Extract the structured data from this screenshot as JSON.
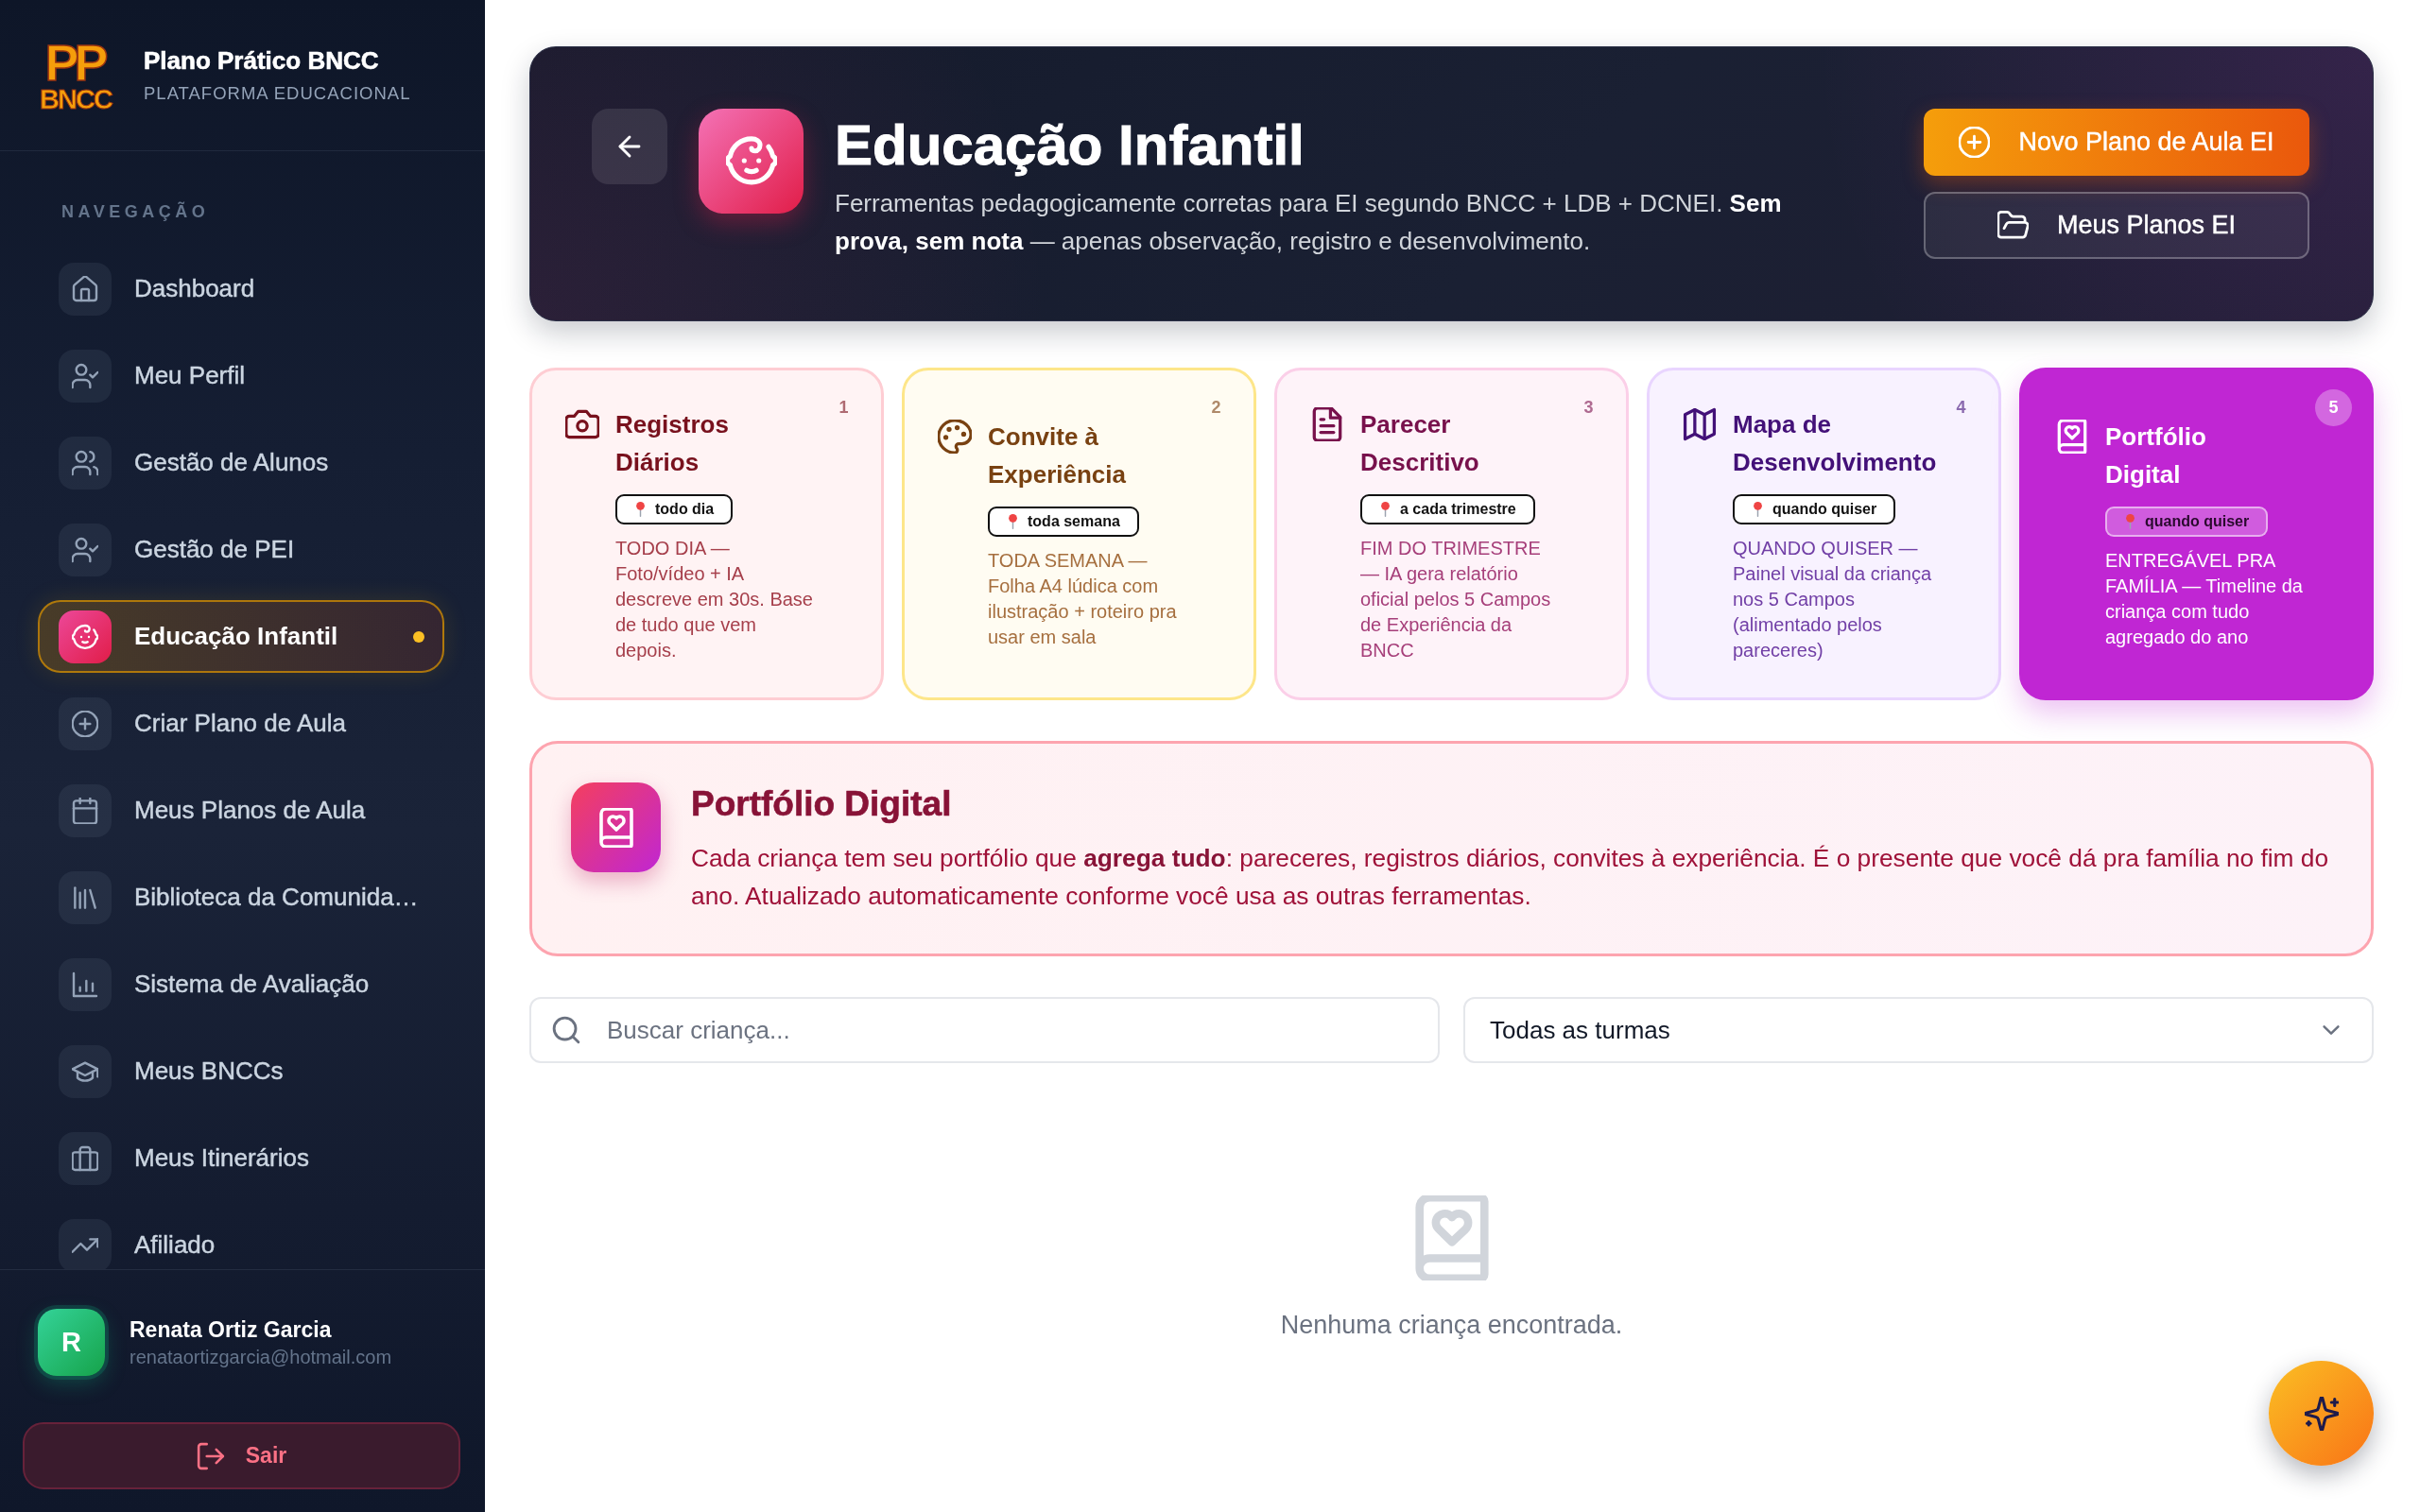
{
  "sidebar": {
    "logo": {
      "monogram": "PP",
      "wordmark": "BNCC"
    },
    "title": "Plano Prático BNCC",
    "subtitle": "PLATAFORMA EDUCACIONAL",
    "section_label": "NAVEGAÇÃO",
    "items": [
      {
        "label": "Dashboard",
        "selected": false
      },
      {
        "label": "Meu Perfil",
        "selected": false
      },
      {
        "label": "Gestão de Alunos",
        "selected": false
      },
      {
        "label": "Gestão de PEI",
        "selected": false
      },
      {
        "label": "Educação Infantil",
        "selected": true
      },
      {
        "label": "Criar Plano de Aula",
        "selected": false
      },
      {
        "label": "Meus Planos de Aula",
        "selected": false
      },
      {
        "label": "Biblioteca da Comunida…",
        "selected": false
      },
      {
        "label": "Sistema de Avaliação",
        "selected": false
      },
      {
        "label": "Meus BNCCs",
        "selected": false
      },
      {
        "label": "Meus Itinerários",
        "selected": false
      },
      {
        "label": "Afiliado",
        "selected": false
      }
    ],
    "user": {
      "initial": "R",
      "name": "Renata Ortiz Garcia",
      "email": "renataortizgarcia@hotmail.com"
    },
    "logout_button": "Sair"
  },
  "header": {
    "title": "Educação Infantil",
    "description": "Ferramentas pedagogicamente corretas para EI segundo BNCC + LDB + DCNEI. **Sem prova, sem nota** — apenas observação, registro e desenvolvimento.",
    "buttons": [
      {
        "label": "Novo Plano de Aula EI",
        "kind": "primary"
      },
      {
        "label": "Meus Planos EI",
        "kind": "secondary"
      }
    ]
  },
  "tools": [
    {
      "number": "1",
      "title": "Registros Diários",
      "tag": "todo dia",
      "description": "TODO DIA — Foto/vídeo + IA descreve em 30s. Base de tudo que vem depois.",
      "color": "#fecdd3",
      "selected": false
    },
    {
      "number": "2",
      "title": "Convite à Experiência",
      "tag": "toda semana",
      "description": "TODA SEMANA — Folha A4 lúdica com ilustração + roteiro pra usar em sala",
      "color": "#fde68a",
      "selected": false
    },
    {
      "number": "3",
      "title": "Parecer Descritivo",
      "tag": "a cada trimestre",
      "description": "FIM DO TRIMESTRE — IA gera relatório oficial pelos 5 Campos de Experiência da BNCC",
      "color": "#fbcfe8",
      "selected": false
    },
    {
      "number": "4",
      "title": "Mapa de Desenvolvimento",
      "tag": "quando quiser",
      "description": "QUANDO QUISER — Painel visual da criança nos 5 Campos (alimentado pelos pareceres)",
      "color": "#e9d5ff",
      "selected": false
    },
    {
      "number": "5",
      "title": "Portfólio Digital",
      "tag": "quando quiser",
      "description": "ENTREGÁVEL PRA FAMÍLIA — Timeline da criança com tudo agregado do ano",
      "color": "#c026d3",
      "selected": true
    }
  ],
  "info_banner": {
    "title": "Portfólio Digital",
    "text": "Cada criança tem seu portfólio que **agrega tudo**: pareceres, registros diários, convites à experiência. É o presente que você dá pra família no fim do ano. Atualizado automaticamente conforme você usa as outras ferramentas."
  },
  "filters": {
    "search": {
      "placeholder": "Buscar criança..."
    },
    "class_select": {
      "value": "Todas as turmas"
    }
  },
  "empty_state": {
    "message": "Nenhuma criança encontrada."
  }
}
